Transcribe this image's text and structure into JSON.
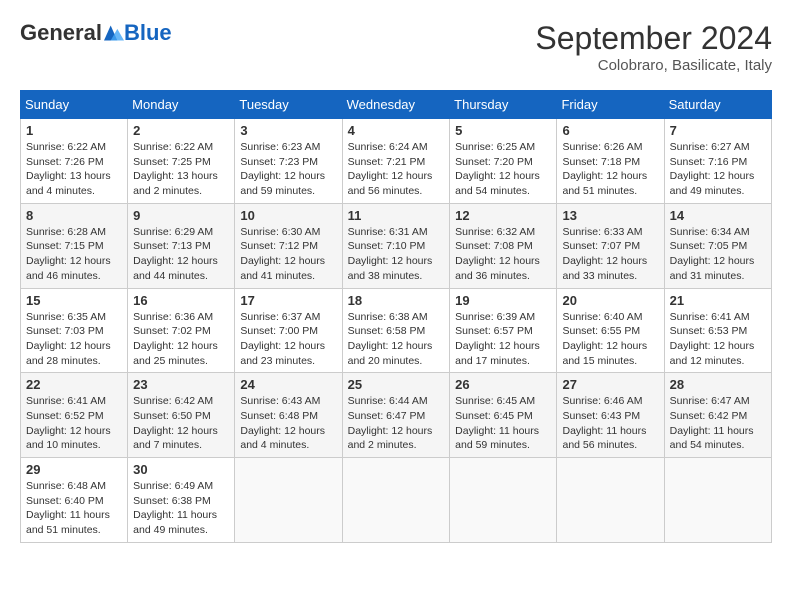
{
  "header": {
    "logo_general": "General",
    "logo_blue": "Blue",
    "month_title": "September 2024",
    "location": "Colobraro, Basilicate, Italy"
  },
  "weekdays": [
    "Sunday",
    "Monday",
    "Tuesday",
    "Wednesday",
    "Thursday",
    "Friday",
    "Saturday"
  ],
  "weeks": [
    [
      {
        "day": "1",
        "sunrise": "6:22 AM",
        "sunset": "7:26 PM",
        "daylight": "13 hours and 4 minutes."
      },
      {
        "day": "2",
        "sunrise": "6:22 AM",
        "sunset": "7:25 PM",
        "daylight": "13 hours and 2 minutes."
      },
      {
        "day": "3",
        "sunrise": "6:23 AM",
        "sunset": "7:23 PM",
        "daylight": "12 hours and 59 minutes."
      },
      {
        "day": "4",
        "sunrise": "6:24 AM",
        "sunset": "7:21 PM",
        "daylight": "12 hours and 56 minutes."
      },
      {
        "day": "5",
        "sunrise": "6:25 AM",
        "sunset": "7:20 PM",
        "daylight": "12 hours and 54 minutes."
      },
      {
        "day": "6",
        "sunrise": "6:26 AM",
        "sunset": "7:18 PM",
        "daylight": "12 hours and 51 minutes."
      },
      {
        "day": "7",
        "sunrise": "6:27 AM",
        "sunset": "7:16 PM",
        "daylight": "12 hours and 49 minutes."
      }
    ],
    [
      {
        "day": "8",
        "sunrise": "6:28 AM",
        "sunset": "7:15 PM",
        "daylight": "12 hours and 46 minutes."
      },
      {
        "day": "9",
        "sunrise": "6:29 AM",
        "sunset": "7:13 PM",
        "daylight": "12 hours and 44 minutes."
      },
      {
        "day": "10",
        "sunrise": "6:30 AM",
        "sunset": "7:12 PM",
        "daylight": "12 hours and 41 minutes."
      },
      {
        "day": "11",
        "sunrise": "6:31 AM",
        "sunset": "7:10 PM",
        "daylight": "12 hours and 38 minutes."
      },
      {
        "day": "12",
        "sunrise": "6:32 AM",
        "sunset": "7:08 PM",
        "daylight": "12 hours and 36 minutes."
      },
      {
        "day": "13",
        "sunrise": "6:33 AM",
        "sunset": "7:07 PM",
        "daylight": "12 hours and 33 minutes."
      },
      {
        "day": "14",
        "sunrise": "6:34 AM",
        "sunset": "7:05 PM",
        "daylight": "12 hours and 31 minutes."
      }
    ],
    [
      {
        "day": "15",
        "sunrise": "6:35 AM",
        "sunset": "7:03 PM",
        "daylight": "12 hours and 28 minutes."
      },
      {
        "day": "16",
        "sunrise": "6:36 AM",
        "sunset": "7:02 PM",
        "daylight": "12 hours and 25 minutes."
      },
      {
        "day": "17",
        "sunrise": "6:37 AM",
        "sunset": "7:00 PM",
        "daylight": "12 hours and 23 minutes."
      },
      {
        "day": "18",
        "sunrise": "6:38 AM",
        "sunset": "6:58 PM",
        "daylight": "12 hours and 20 minutes."
      },
      {
        "day": "19",
        "sunrise": "6:39 AM",
        "sunset": "6:57 PM",
        "daylight": "12 hours and 17 minutes."
      },
      {
        "day": "20",
        "sunrise": "6:40 AM",
        "sunset": "6:55 PM",
        "daylight": "12 hours and 15 minutes."
      },
      {
        "day": "21",
        "sunrise": "6:41 AM",
        "sunset": "6:53 PM",
        "daylight": "12 hours and 12 minutes."
      }
    ],
    [
      {
        "day": "22",
        "sunrise": "6:41 AM",
        "sunset": "6:52 PM",
        "daylight": "12 hours and 10 minutes."
      },
      {
        "day": "23",
        "sunrise": "6:42 AM",
        "sunset": "6:50 PM",
        "daylight": "12 hours and 7 minutes."
      },
      {
        "day": "24",
        "sunrise": "6:43 AM",
        "sunset": "6:48 PM",
        "daylight": "12 hours and 4 minutes."
      },
      {
        "day": "25",
        "sunrise": "6:44 AM",
        "sunset": "6:47 PM",
        "daylight": "12 hours and 2 minutes."
      },
      {
        "day": "26",
        "sunrise": "6:45 AM",
        "sunset": "6:45 PM",
        "daylight": "11 hours and 59 minutes."
      },
      {
        "day": "27",
        "sunrise": "6:46 AM",
        "sunset": "6:43 PM",
        "daylight": "11 hours and 56 minutes."
      },
      {
        "day": "28",
        "sunrise": "6:47 AM",
        "sunset": "6:42 PM",
        "daylight": "11 hours and 54 minutes."
      }
    ],
    [
      {
        "day": "29",
        "sunrise": "6:48 AM",
        "sunset": "6:40 PM",
        "daylight": "11 hours and 51 minutes."
      },
      {
        "day": "30",
        "sunrise": "6:49 AM",
        "sunset": "6:38 PM",
        "daylight": "11 hours and 49 minutes."
      },
      null,
      null,
      null,
      null,
      null
    ]
  ]
}
